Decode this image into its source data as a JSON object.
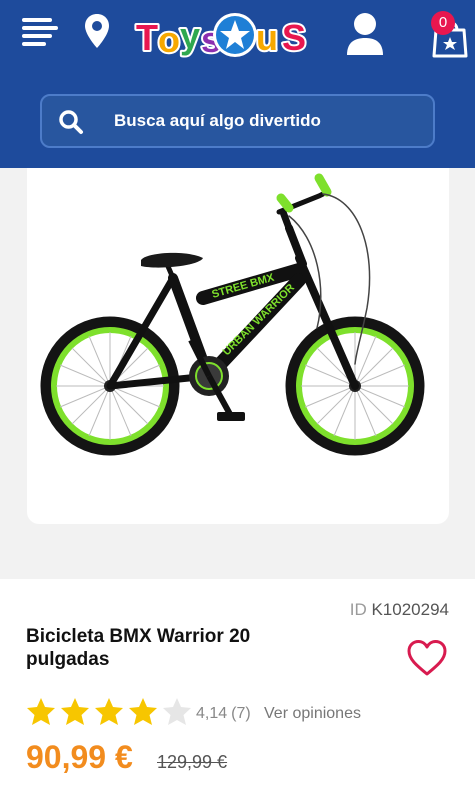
{
  "header": {
    "menu_icon": "hamburger-menu-icon",
    "location_icon": "map-pin-icon",
    "logo_text": "ToysRUs",
    "account_icon": "user-icon",
    "cart_icon": "shopping-bag-icon",
    "cart_count": "0",
    "colors": {
      "background": "#1e4b9c",
      "badge": "#e8174f"
    }
  },
  "search": {
    "icon": "search-icon",
    "placeholder": "Busca aquí algo divertido"
  },
  "product": {
    "image_alt": "Bicicleta BMX Warrior 20 pulgadas",
    "id_label": "ID",
    "id_value": "K1020294",
    "title": "Bicicleta BMX Warrior 20 pulgadas",
    "favorite_icon": "heart-icon",
    "rating_value": "4,14",
    "rating_count": "(7)",
    "rating_stars": 4.14,
    "rating_max": 5,
    "reviews_link": "Ver opiniones",
    "price": "90,99 €",
    "old_price": "129,99 €",
    "colors": {
      "price": "#f28c1e",
      "star": "#f7c600",
      "heart": "#d81b4f"
    }
  }
}
